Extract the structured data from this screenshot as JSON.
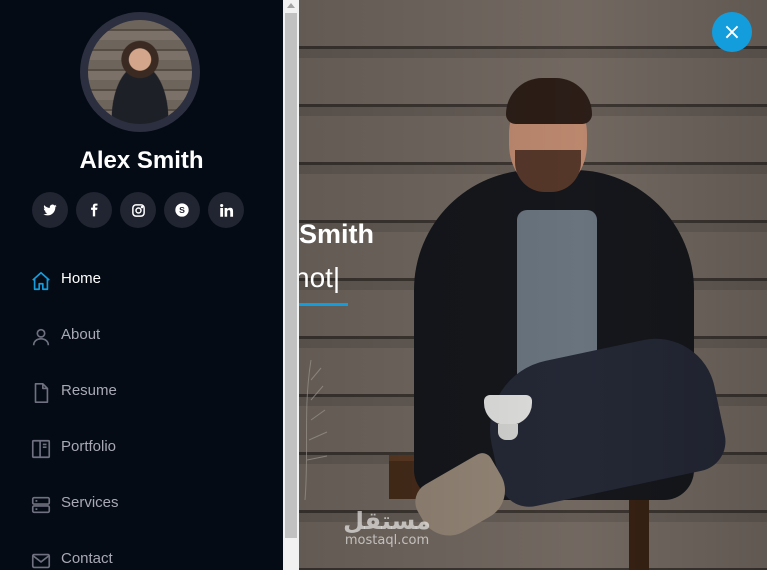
{
  "profile": {
    "name": "Alex Smith",
    "avatar_icon": "avatar-photo"
  },
  "socials": [
    {
      "icon": "twitter-icon",
      "glyph": "🐦"
    },
    {
      "icon": "facebook-icon",
      "glyph": "f"
    },
    {
      "icon": "instagram-icon",
      "glyph": "◎"
    },
    {
      "icon": "skype-icon",
      "glyph": "S"
    },
    {
      "icon": "linkedin-icon",
      "glyph": "in"
    }
  ],
  "nav": [
    {
      "label": "Home",
      "icon": "home-icon",
      "active": true
    },
    {
      "label": "About",
      "icon": "person-icon",
      "active": false
    },
    {
      "label": "Resume",
      "icon": "file-icon",
      "active": false
    },
    {
      "label": "Portfolio",
      "icon": "book-icon",
      "active": false
    },
    {
      "label": "Services",
      "icon": "server-icon",
      "active": false
    },
    {
      "label": "Contact",
      "icon": "envelope-icon",
      "active": false
    }
  ],
  "hero": {
    "title": "Smith",
    "typed": "hot|"
  },
  "watermark": {
    "arabic": "مستقل",
    "latin": "mostaql.com"
  },
  "close_button": {
    "glyph": "×",
    "icon": "close-icon"
  },
  "colors": {
    "accent": "#149ddd",
    "sidebar_bg": "#040b14",
    "social_bg": "#212431",
    "nav_text": "#a8a9b4"
  }
}
